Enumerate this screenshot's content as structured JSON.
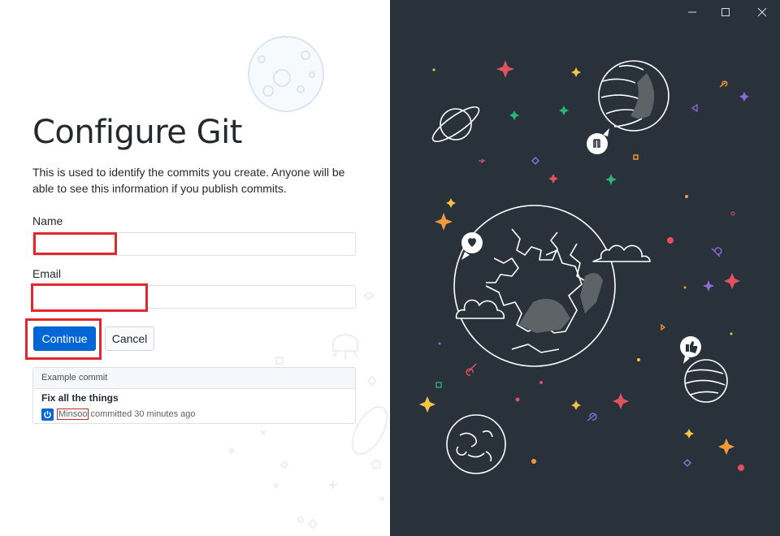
{
  "page": {
    "title": "Configure Git",
    "description": "This is used to identify the commits you create. Anyone will be able to see this information if you publish commits."
  },
  "form": {
    "name_label": "Name",
    "name_value": "",
    "email_label": "Email",
    "email_value": "",
    "continue_label": "Continue",
    "cancel_label": "Cancel"
  },
  "example_commit": {
    "header": "Example commit",
    "summary": "Fix all the things",
    "author": "Minsoo",
    "meta": "committed 30 minutes ago"
  },
  "window_controls": [
    "minimize-icon",
    "maximize-icon",
    "close-icon"
  ],
  "colors": {
    "primary": "#0366d6",
    "illustration_bg": "#29323a",
    "highlight": "#e0282e"
  }
}
